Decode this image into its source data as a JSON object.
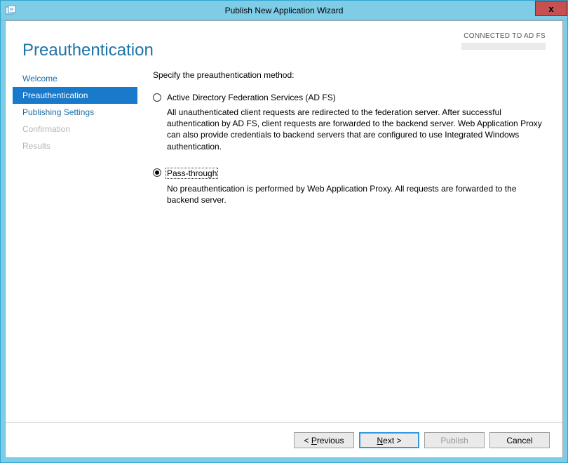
{
  "titlebar": {
    "title": "Publish New Application Wizard",
    "close_glyph": "x"
  },
  "header": {
    "page_title": "Preauthentication",
    "connection_label": "CONNECTED TO AD FS"
  },
  "sidebar": {
    "items": [
      {
        "label": "Welcome",
        "state": "normal"
      },
      {
        "label": "Preauthentication",
        "state": "active"
      },
      {
        "label": "Publishing Settings",
        "state": "normal"
      },
      {
        "label": "Confirmation",
        "state": "disabled"
      },
      {
        "label": "Results",
        "state": "disabled"
      }
    ]
  },
  "main": {
    "instruction": "Specify the preauthentication method:",
    "options": [
      {
        "id": "adfs",
        "label": "Active Directory Federation Services (AD FS)",
        "selected": false,
        "description": "All unauthenticated client requests are redirected to the federation server. After successful authentication by AD FS, client requests are forwarded to the backend server. Web Application Proxy can also provide credentials to backend servers that are configured to use Integrated Windows authentication."
      },
      {
        "id": "passthrough",
        "label": "Pass-through",
        "selected": true,
        "description": "No preauthentication is performed by Web Application Proxy. All requests are forwarded to the backend server."
      }
    ]
  },
  "footer": {
    "previous_prefix": "< ",
    "previous_u": "P",
    "previous_rest": "revious",
    "next_u": "N",
    "next_rest": "ext >",
    "publish": "Publish",
    "cancel": "Cancel"
  }
}
